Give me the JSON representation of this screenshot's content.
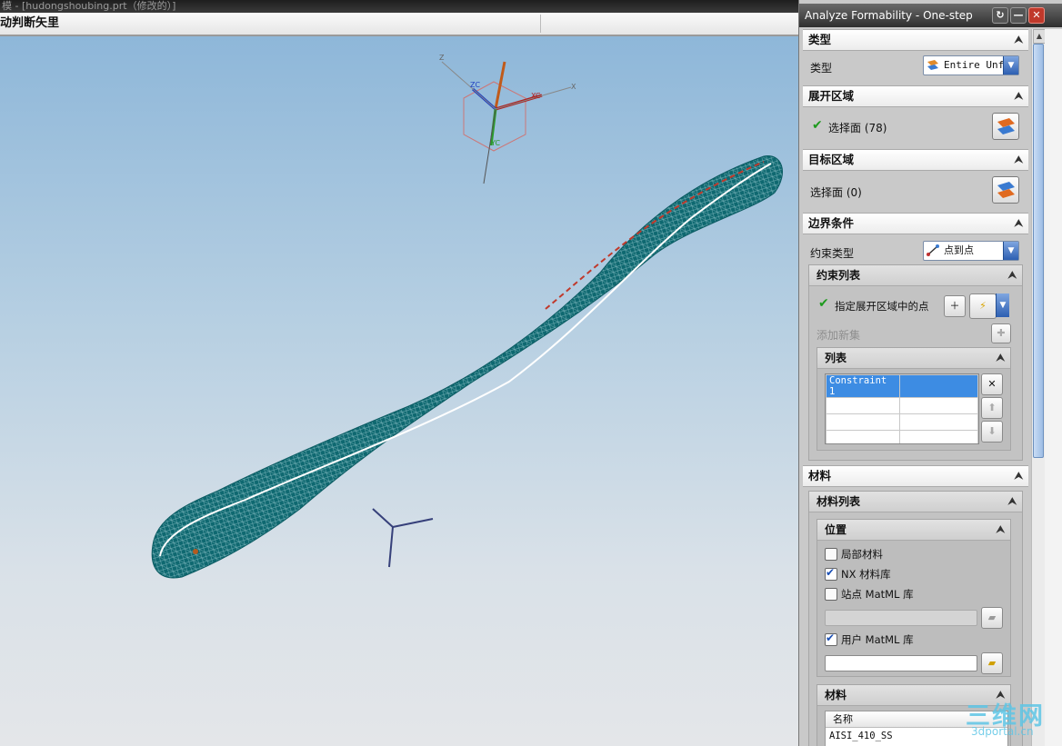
{
  "window": {
    "title": "模 - [hudongshoubing.prt（修改的）]",
    "cue_line": "动判断矢里"
  },
  "viewport": {
    "csys_labels": {
      "zc": "ZC",
      "xc": "XC",
      "yc": "YC",
      "z": "Z",
      "x": "X"
    }
  },
  "dialog": {
    "title": "Analyze Formability - One-step",
    "buttons": {
      "reset": "↻",
      "minimize": "—",
      "close": "✕"
    },
    "type_section": {
      "header": "类型",
      "label": "类型",
      "dropdown_value": "Entire Unfo"
    },
    "unfold_region": {
      "header": "展开区域",
      "select_label": "选择面 (78)"
    },
    "target_region": {
      "header": "目标区域",
      "select_label": "选择面 (0)"
    },
    "boundary": {
      "header": "边界条件",
      "constraint_type_label": "约束类型",
      "constraint_type_value": "点到点",
      "constraint_list": {
        "header": "约束列表",
        "specify_point_label": "指定展开区域中的点",
        "add_new_set": "添加新集",
        "list": {
          "header": "列表",
          "rows": [
            [
              "Constraint 1",
              ""
            ],
            [
              "",
              ""
            ],
            [
              "",
              ""
            ],
            [
              "",
              ""
            ]
          ]
        }
      }
    },
    "material": {
      "header": "材料",
      "material_list_header": "材料列表",
      "location": {
        "header": "位置",
        "options": [
          {
            "label": "局部材料",
            "checked": false
          },
          {
            "label": "NX 材料库",
            "checked": true
          },
          {
            "label": "站点 MatML 库",
            "checked": false
          },
          {
            "label": "用户 MatML 库",
            "checked": true
          }
        ]
      },
      "materials": {
        "header": "材料",
        "column_name": "名称",
        "first_row": "AISI_410_SS"
      }
    }
  },
  "watermark": {
    "big": "三维网",
    "small": "3dportal.cn"
  },
  "colors": {
    "mesh": "#0e6870",
    "accent_blue": "#3d8ce3",
    "check_green": "#1e9a1e"
  }
}
